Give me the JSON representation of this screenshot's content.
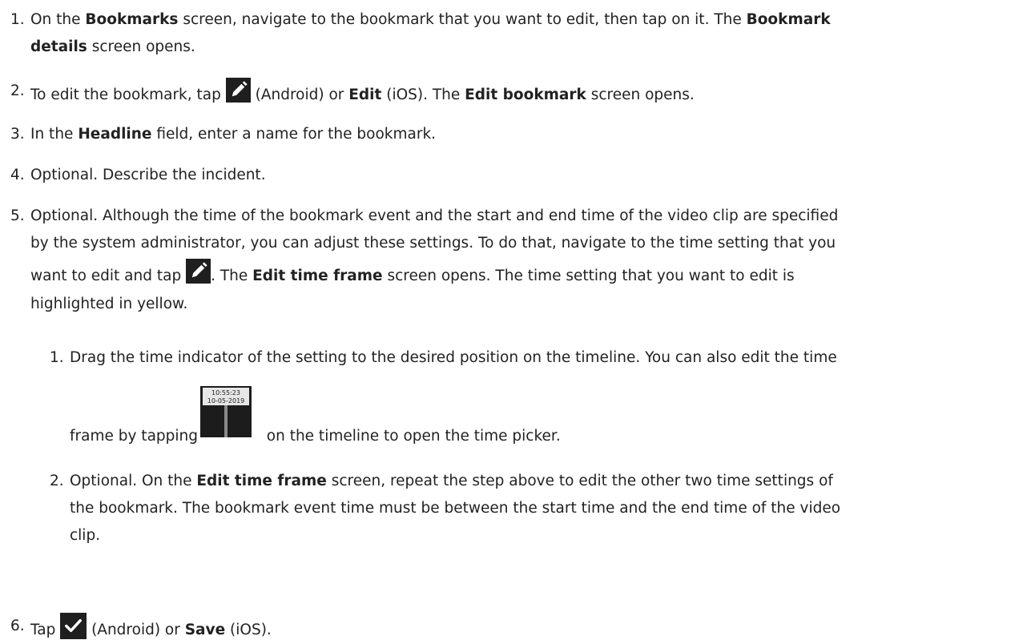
{
  "steps": [
    {
      "number": "1.",
      "pre": "On the ",
      "b1": "Bookmarks",
      "mid1": " screen, navigate to the bookmark that you want to edit, then tap on it. The ",
      "b2": "Bookmark",
      "line2_b": "details",
      "line2_rest": " screen opens."
    },
    {
      "number": "2.",
      "pre": "To edit the bookmark, tap ",
      "mid1": " (Android) or ",
      "b1": "Edit",
      "mid2": " (iOS). The ",
      "b2": "Edit bookmark",
      "post": " screen opens."
    },
    {
      "number": "3.",
      "pre": "In the ",
      "b1": "Headline",
      "post": " field, enter a name for the bookmark."
    },
    {
      "number": "4.",
      "text": "Optional. Describe the incident."
    },
    {
      "number": "5.",
      "line1": "Optional. Although the time of the bookmark event and the start and end time of the video clip are specified",
      "line2": "by the system administrator, you can adjust these settings. To do that, navigate to the time setting that you",
      "line3_pre": "want to edit and tap ",
      "line3_mid": ". The ",
      "line3_b": "Edit time frame",
      "line3_post": " screen opens. The time setting that you want to edit is",
      "line4": "highlighted in yellow.",
      "substeps": [
        {
          "number": "1.",
          "line1": "Drag the time indicator of the setting to the desired position on the timeline. You can also edit the time",
          "line2_pre": "frame by tapping ",
          "line2_post": " on the timeline to open the time picker.",
          "marker_time": "10:55:23",
          "marker_date": "10-05-2019"
        },
        {
          "number": "2.",
          "pre": "Optional. On the ",
          "b1": "Edit time frame",
          "line1_post": " screen, repeat the step above to edit the other two time settings of",
          "line2": "the bookmark. The bookmark event time must be between the start time and the end time of the video",
          "line3": "clip."
        }
      ]
    },
    {
      "number": "6.",
      "pre": "Tap ",
      "mid1": " (Android) or ",
      "b1": "Save",
      "post": " (iOS)."
    }
  ],
  "icons": {
    "edit": "pencil-icon",
    "save": "checkmark-icon",
    "timeline": "time-marker-icon"
  }
}
